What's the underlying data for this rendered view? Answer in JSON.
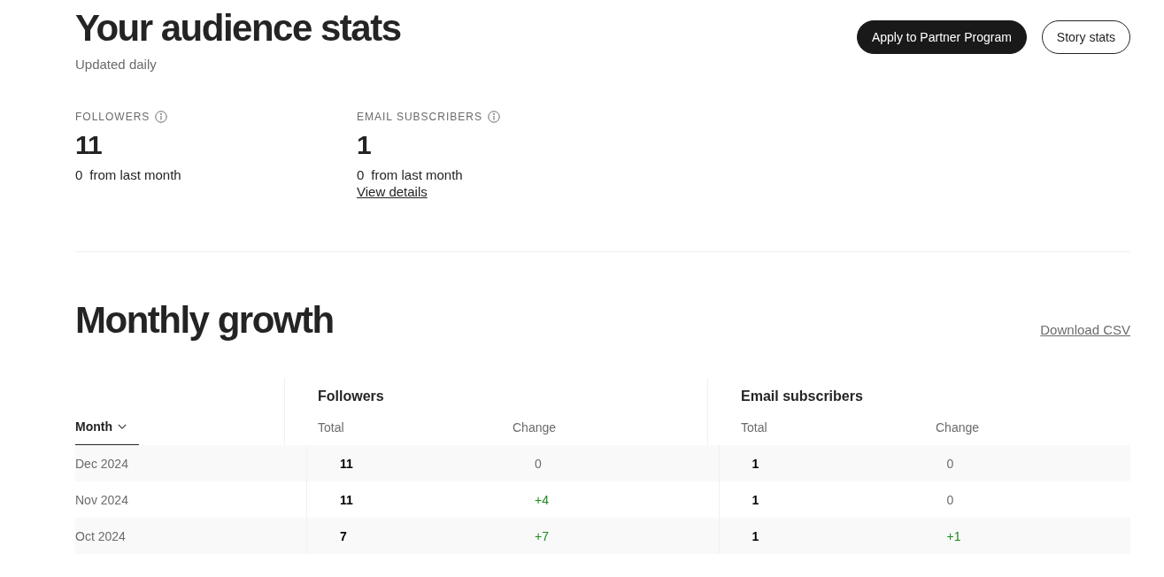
{
  "header": {
    "title": "Your audience stats",
    "subtitle": "Updated daily",
    "buttons": [
      {
        "label": "Apply to Partner Program",
        "kind": "primary"
      },
      {
        "label": "Story stats",
        "kind": "outline"
      }
    ]
  },
  "stats": [
    {
      "label": "FOLLOWERS",
      "value": "11",
      "change": "0",
      "change_text": "from last month"
    },
    {
      "label": "EMAIL SUBSCRIBERS",
      "value": "1",
      "change": "0",
      "change_text": "from last month",
      "link": "View details"
    }
  ],
  "growth": {
    "title": "Monthly growth",
    "download": "Download CSV",
    "month_header": "Month",
    "groups": [
      {
        "title": "Followers",
        "columns": [
          "Total",
          "Change"
        ]
      },
      {
        "title": "Email subscribers",
        "columns": [
          "Total",
          "Change"
        ]
      }
    ],
    "rows": [
      {
        "month": "Dec 2024",
        "cells": [
          {
            "total": "11",
            "change": "0",
            "positive": false
          },
          {
            "total": "1",
            "change": "0",
            "positive": false
          }
        ]
      },
      {
        "month": "Nov 2024",
        "cells": [
          {
            "total": "11",
            "change": "+4",
            "positive": true
          },
          {
            "total": "1",
            "change": "0",
            "positive": false
          }
        ]
      },
      {
        "month": "Oct 2024",
        "cells": [
          {
            "total": "7",
            "change": "+7",
            "positive": true
          },
          {
            "total": "1",
            "change": "+1",
            "positive": true
          }
        ]
      }
    ]
  }
}
